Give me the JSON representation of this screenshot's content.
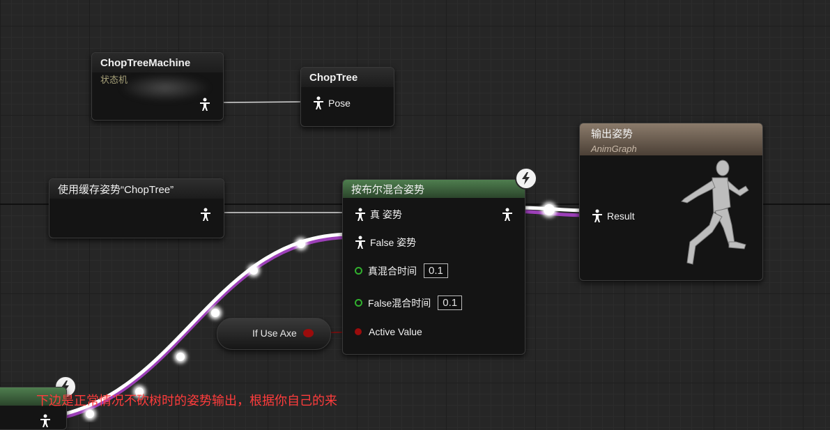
{
  "nodes": {
    "chop_tree_machine": {
      "title": "ChopTreeMachine",
      "subtitle": "状态机"
    },
    "chop_tree": {
      "title": "ChopTree",
      "pose_label": "Pose"
    },
    "use_cached_pose": {
      "title": "使用缓存姿势“ChopTree”"
    },
    "blend_by_bool": {
      "title": "按布尔混合姿势",
      "true_pose": "真 姿势",
      "false_pose": "False 姿势",
      "true_blend_time_label": "真混合时间",
      "true_blend_time_value": "0.1",
      "false_blend_time_label": "False混合时间",
      "false_blend_time_value": "0.1",
      "active_value": "Active Value"
    },
    "if_use_axe": {
      "label": "If Use Axe"
    },
    "output_pose": {
      "title": "输出姿势",
      "subtitle": "AnimGraph",
      "result_label": "Result"
    }
  },
  "annotation": {
    "text": "下边是正常情况不砍树时的姿势输出，根据你自己的来"
  },
  "colors": {
    "graph_bg": "#262626",
    "blend_header": "#3f6a3f",
    "output_header": "#6f6152",
    "exec_wire": "#ffffff",
    "bool_pin": "#9b0c0c",
    "float_pin": "#31b02e",
    "annotation": "#ff3c3c"
  },
  "icons": {
    "pose_pin": "pose-person-icon",
    "fast_path": "lightning-icon"
  }
}
